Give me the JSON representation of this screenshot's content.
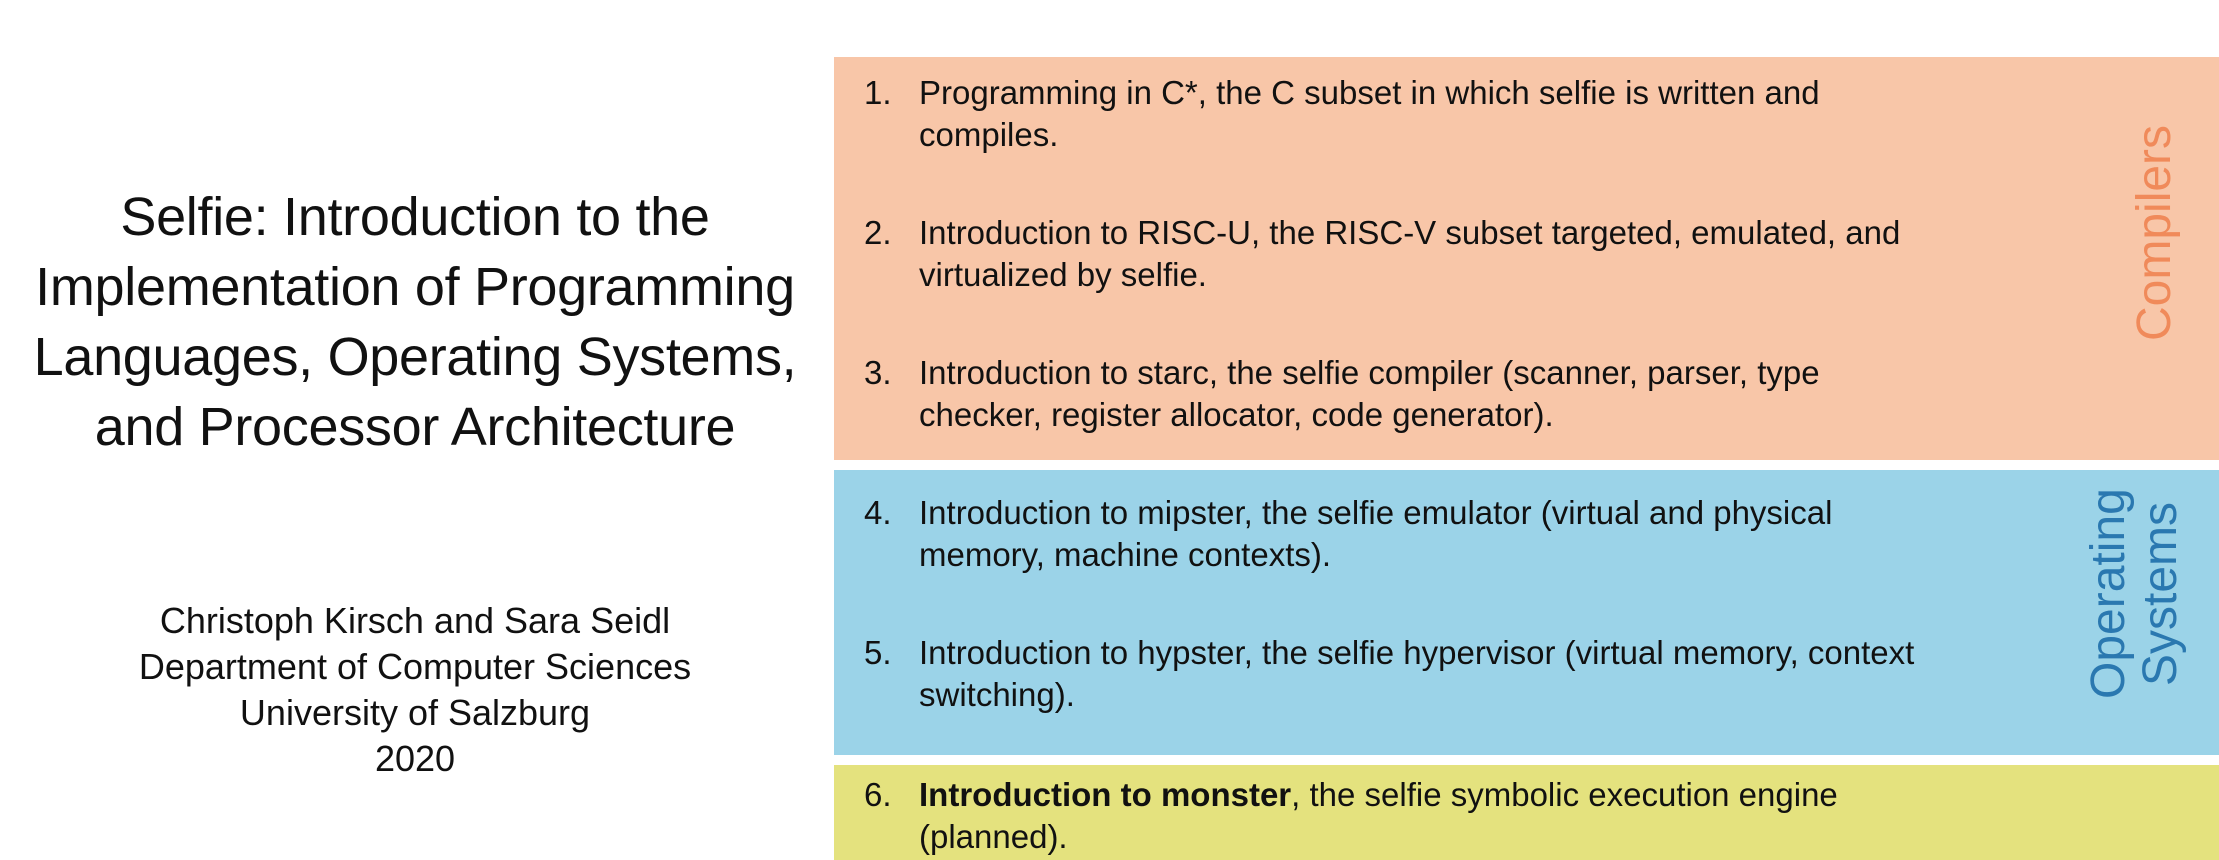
{
  "title": {
    "lines": [
      "Selfie: Introduction to the",
      "Implementation of Programming",
      "Languages, Operating Systems,",
      "and Processor Architecture"
    ]
  },
  "byline": {
    "authors": "Christoph Kirsch and Sara Seidl",
    "department": "Department of Computer Sciences",
    "university": "University of Salzburg",
    "year": "2020"
  },
  "sections": {
    "compilers_label": "Compilers",
    "os_label_line1": "Operating",
    "os_label_line2": "Systems"
  },
  "items": [
    {
      "num": "1.",
      "bold": "",
      "text": "Programming in C*, the C subset in which selfie is written and compiles."
    },
    {
      "num": "2.",
      "bold": "",
      "text": "Introduction to RISC-U, the RISC-V subset targeted, emulated, and virtualized by selfie."
    },
    {
      "num": "3.",
      "bold": "",
      "text": "Introduction to starc, the selfie compiler (scanner, parser, type checker, register allocator, code generator)."
    },
    {
      "num": "4.",
      "bold": "",
      "text": "Introduction to mipster, the selfie emulator (virtual and physical memory, machine contexts)."
    },
    {
      "num": "5.",
      "bold": "",
      "text": "Introduction to hypster, the selfie hypervisor (virtual memory, context switching)."
    },
    {
      "num": "6.",
      "bold": "Introduction to monster",
      "text": ", the selfie symbolic execution engine (planned)."
    }
  ],
  "colors": {
    "compilers_bg": "#f8c6a8",
    "compilers_label": "#f08a5a",
    "os_bg": "#9bd3e8",
    "os_label": "#2a78b0",
    "monster_bg": "#e4e27e"
  }
}
